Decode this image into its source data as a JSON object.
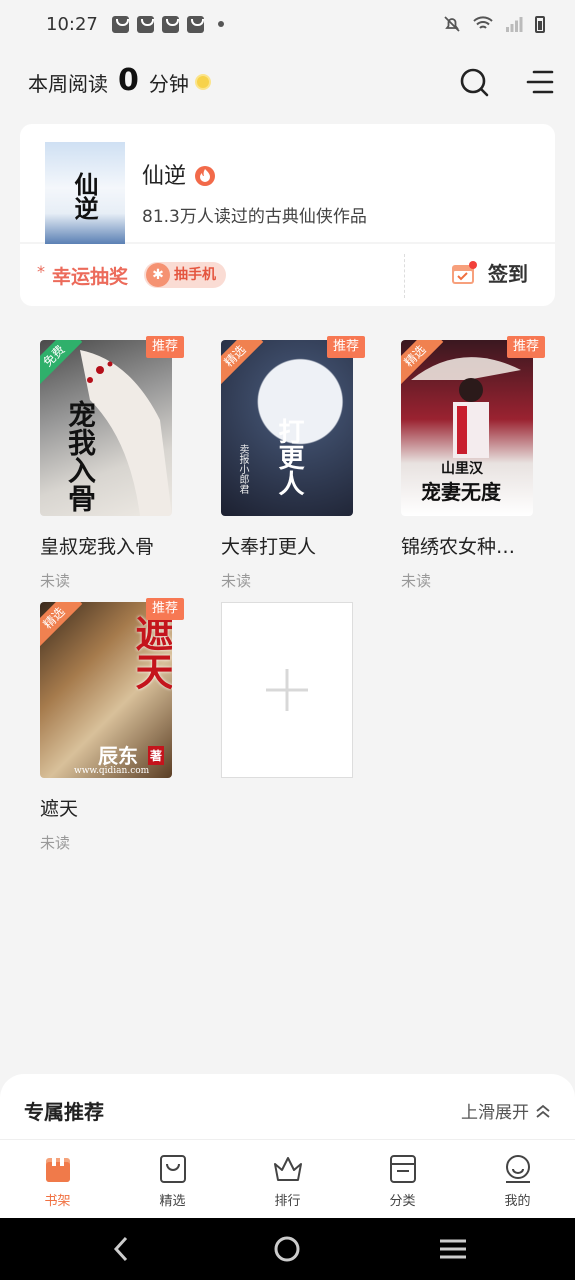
{
  "status_bar": {
    "time": "10:27"
  },
  "header": {
    "reading_label": "本周阅读",
    "reading_minutes": "0",
    "reading_unit": "分钟"
  },
  "featured": {
    "title": "仙逆",
    "cover_text": "仙逆",
    "description": "81.3万人读过的古典仙侠作品"
  },
  "promo": {
    "lottery_label": "幸运抽奖",
    "badge_label": "抽手机",
    "checkin_label": "签到"
  },
  "books": [
    {
      "title": "皇叔宠我入骨",
      "status": "未读",
      "ribbon": "免费",
      "tag": "推荐",
      "cover_text": "宠我入骨"
    },
    {
      "title": "大奉打更人",
      "status": "未读",
      "ribbon": "精选",
      "tag": "推荐",
      "cover_text": "打更人",
      "author": "卖报小郎君"
    },
    {
      "title": "锦绣农女种…",
      "status": "未读",
      "ribbon": "精选",
      "tag": "推荐",
      "cover_text": "宠妻无度",
      "cover_top": "山里汉"
    },
    {
      "title": "遮天",
      "status": "未读",
      "ribbon": "精选",
      "tag": "推荐",
      "cover_text": "遮天",
      "author": "辰东",
      "author_suffix": "著",
      "site": "www.qidian.com"
    }
  ],
  "recommend": {
    "title": "专属推荐",
    "expand_label": "上滑展开"
  },
  "tabs": [
    {
      "label": "书架",
      "icon": "bookshelf-icon",
      "active": true
    },
    {
      "label": "精选",
      "icon": "bag-icon",
      "active": false
    },
    {
      "label": "排行",
      "icon": "crown-icon",
      "active": false
    },
    {
      "label": "分类",
      "icon": "category-icon",
      "active": false
    },
    {
      "label": "我的",
      "icon": "profile-icon",
      "active": false
    }
  ],
  "colors": {
    "accent": "#f07040",
    "tag": "#f77853",
    "ribbon_green": "#2fb06b",
    "ribbon_orange": "#f08150"
  }
}
